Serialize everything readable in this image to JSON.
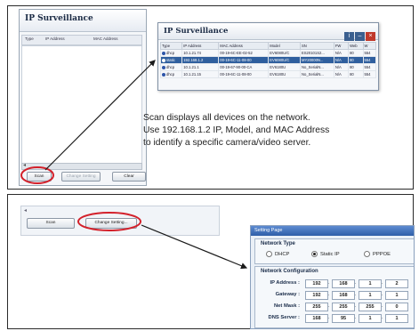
{
  "bg_window": {
    "title": "IP Surveillance",
    "columns": [
      "Type",
      "IP Address",
      "MAC Address"
    ],
    "buttons": [
      "Scan",
      "Change Setting",
      "Clear"
    ]
  },
  "fg_window": {
    "title": "IP Surveillance",
    "columns": [
      "Type",
      "IP Address",
      "MAC Address",
      "Model",
      "SN",
      "FW",
      "Web",
      "W"
    ],
    "rows": [
      [
        "dhcp",
        "10.1.21.74",
        "00-19-6C-EE-02-52",
        "EV6080U/C",
        "ES20101S2...",
        "N/A",
        "80",
        "554"
      ],
      [
        "static",
        "192.168.1.2",
        "00-19-6C-11-08-00",
        "EV6080U/C",
        "MY20000N...",
        "N/A",
        "80",
        "554"
      ],
      [
        "dhcp",
        "10.1.21.1",
        "00-19-67-90-00-CA",
        "EV6180U",
        "No_SerialN...",
        "N/A",
        "80",
        "554"
      ],
      [
        "dhcp",
        "10.1.21.15",
        "00-19-6C-11-08-00",
        "EV6180U",
        "No_SerialN...",
        "N/A",
        "80",
        "554"
      ]
    ]
  },
  "note_lines": [
    "Scan displays all devices on the network.",
    "Use 192.168.1.2 IP, Model, and MAC Address",
    "to identify a specific camera/video server."
  ],
  "strip_buttons": {
    "scan": "Scan",
    "change": "Change Setting..."
  },
  "setting_page": {
    "title": "Setting Page",
    "network_type": {
      "legend": "Network Type",
      "options": [
        "DHCP",
        "Static IP",
        "PPPOE"
      ],
      "selected": "Static IP"
    },
    "network_config": {
      "legend": "Network Configuration",
      "fields": [
        {
          "label": "IP Address :",
          "octets": [
            "192",
            "168",
            "1",
            "2"
          ]
        },
        {
          "label": "Gateway :",
          "octets": [
            "192",
            "168",
            "1",
            "1"
          ]
        },
        {
          "label": "Net Mask :",
          "octets": [
            "255",
            "255",
            "255",
            "0"
          ]
        },
        {
          "label": "DNS Server :",
          "octets": [
            "168",
            "95",
            "1",
            "1"
          ]
        }
      ]
    }
  },
  "colors": {
    "highlight_circle": "#d3202a",
    "selected_row": "#2f5f9e",
    "arrow": "#1a1a1a"
  }
}
